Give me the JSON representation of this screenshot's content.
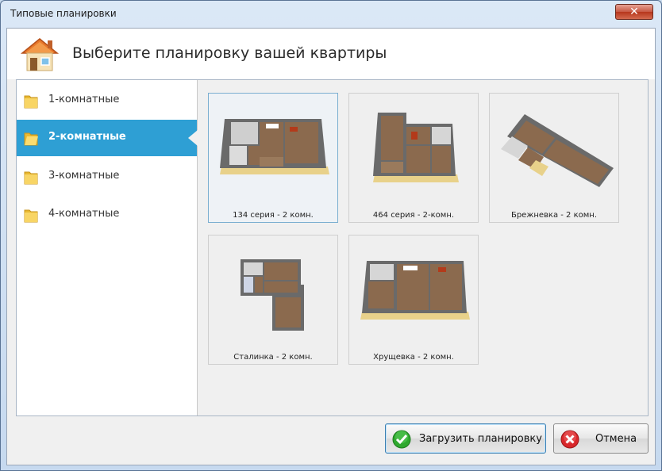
{
  "window": {
    "title": "Типовые планировки",
    "close_glyph": "✕"
  },
  "header": {
    "title": "Выберите планировку вашей квартиры",
    "icon": "house-icon"
  },
  "sidebar": {
    "items": [
      {
        "label": "1-комнатные",
        "active": false
      },
      {
        "label": "2-комнатные",
        "active": true
      },
      {
        "label": "3-комнатные",
        "active": false
      },
      {
        "label": "4-комнатные",
        "active": false
      }
    ]
  },
  "layouts": [
    {
      "caption": "134 серия - 2 комн.",
      "selected": true
    },
    {
      "caption": "464 серия - 2-комн.",
      "selected": false
    },
    {
      "caption": "Брежневка - 2 комн.",
      "selected": false
    },
    {
      "caption": "Сталинка - 2 комн.",
      "selected": false
    },
    {
      "caption": "Хрущевка - 2 комн.",
      "selected": false
    }
  ],
  "buttons": {
    "load_label": "Загрузить планировку",
    "cancel_label": "Отмена"
  },
  "colors": {
    "accent": "#2e9fd4",
    "floor": "#8b6a4e",
    "wall": "#555555",
    "ok_green": "#2fa82f",
    "cancel_red": "#d8262a"
  }
}
